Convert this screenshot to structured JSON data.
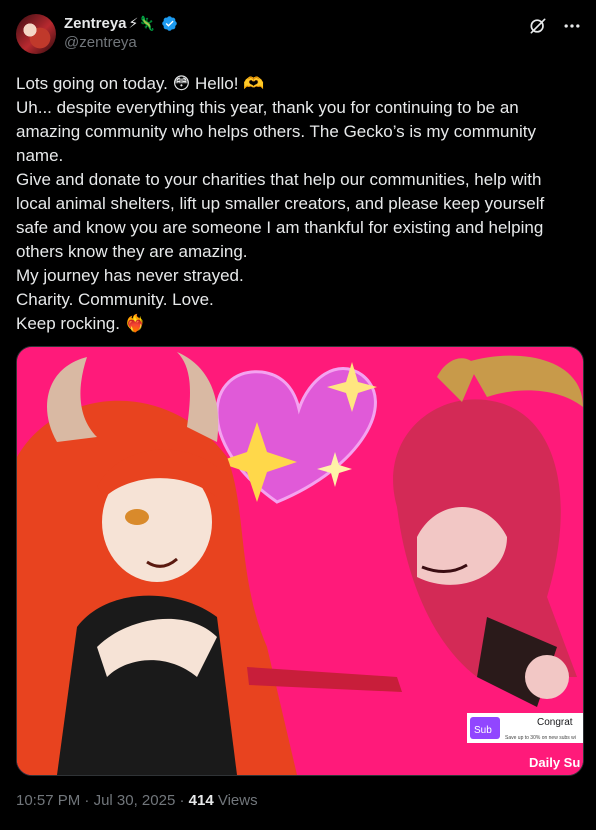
{
  "author": {
    "display_name": "Zentreya",
    "name_emojis": "⚡🦎",
    "handle": "@zentreya",
    "verified": true
  },
  "header_icons": [
    "grok-icon",
    "more-icon"
  ],
  "tweet": {
    "lines": [
      "Lots going on today. 😳 Hello! 🫶",
      "Uh... despite everything this year, thank you for continuing to be an amazing community who helps others. The Gecko’s is my community name.",
      "Give and donate to your charities that help our communities, help with local animal shelters, lift up smaller creators, and please keep yourself safe and know you are someone I am thankful for existing and helping others know they are amazing.",
      "My journey has never strayed.",
      "Charity. Community. Love.",
      "Keep rocking. ❤️‍🔥"
    ]
  },
  "media": {
    "overlay_badge": "Sub",
    "overlay_text": "Save up to 30% on new subs wi",
    "overlay_title": "Congrat",
    "corner_text": "Daily Su",
    "colors": {
      "background": "#ff1a7a",
      "hair": "#e8431f",
      "heart": "#e05ad8"
    }
  },
  "meta": {
    "time": "10:57 PM",
    "date": "Jul 30, 2025",
    "views_count": "414",
    "views_label": "Views"
  }
}
